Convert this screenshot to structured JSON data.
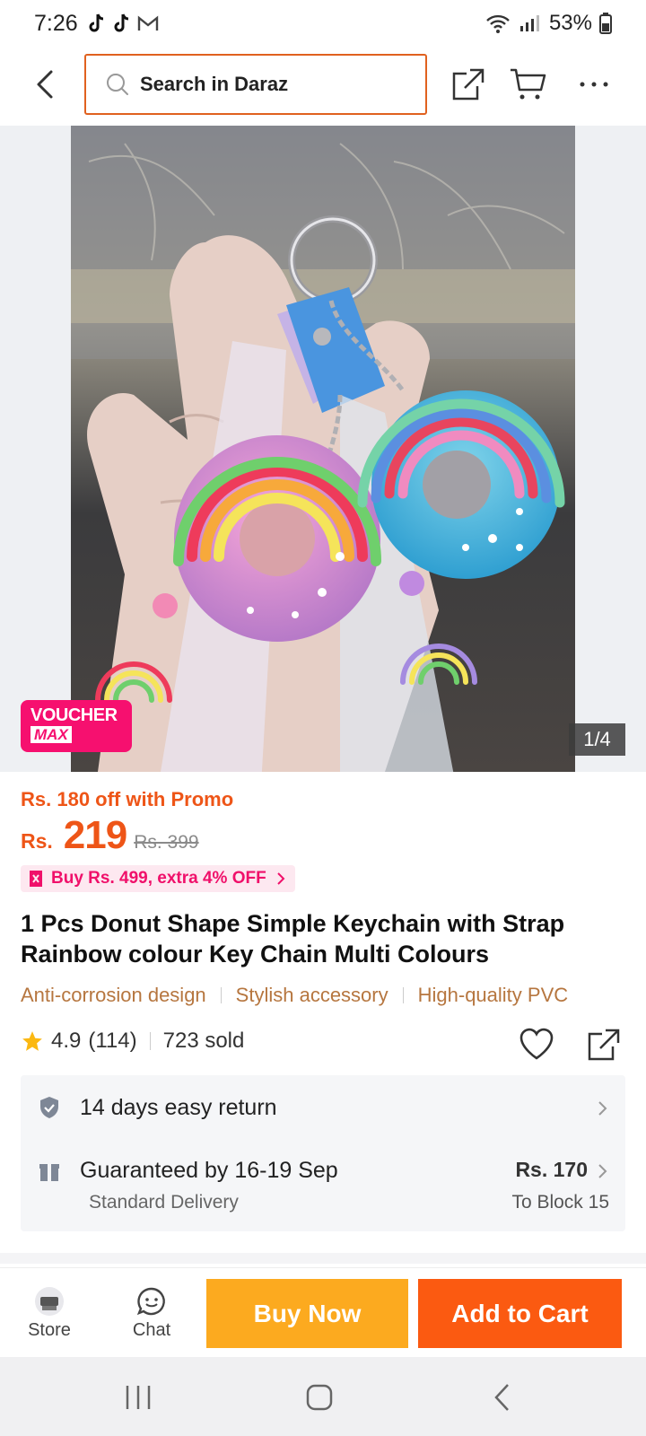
{
  "status_bar": {
    "time": "7:26",
    "battery": "53%"
  },
  "search": {
    "placeholder": "Search in Daraz"
  },
  "gallery": {
    "voucher_line1": "VOUCHER",
    "voucher_line2": "MAX",
    "counter": "1/4"
  },
  "product": {
    "promo_text": "Rs. 180 off with Promo",
    "price_currency": "Rs.",
    "price": "219",
    "old_price": "Rs. 399",
    "bundle_promo": "Buy Rs. 499, extra 4% OFF",
    "title": "1 Pcs Donut Shape Simple Keychain with Strap Rainbow colour Key Chain Multi Colours",
    "features": [
      "Anti-corrosion design",
      "Stylish accessory",
      "High-quality PVC"
    ],
    "rating": "4.9",
    "rating_count": "(114)",
    "sold": "723 sold"
  },
  "services": {
    "return_text": "14 days easy return",
    "delivery_text": "Guaranteed by 16-19 Sep",
    "delivery_type": "Standard Delivery",
    "delivery_fee": "Rs. 170",
    "delivery_dest": "To Block 15"
  },
  "bottom_bar": {
    "store_label": "Store",
    "chat_label": "Chat",
    "buy_now_label": "Buy Now",
    "add_to_cart_label": "Add to Cart"
  },
  "colors": {
    "accent": "#fb5a11",
    "buy_now": "#fcaa1f",
    "voucher": "#f6106f",
    "feature_text": "#b6763f"
  }
}
